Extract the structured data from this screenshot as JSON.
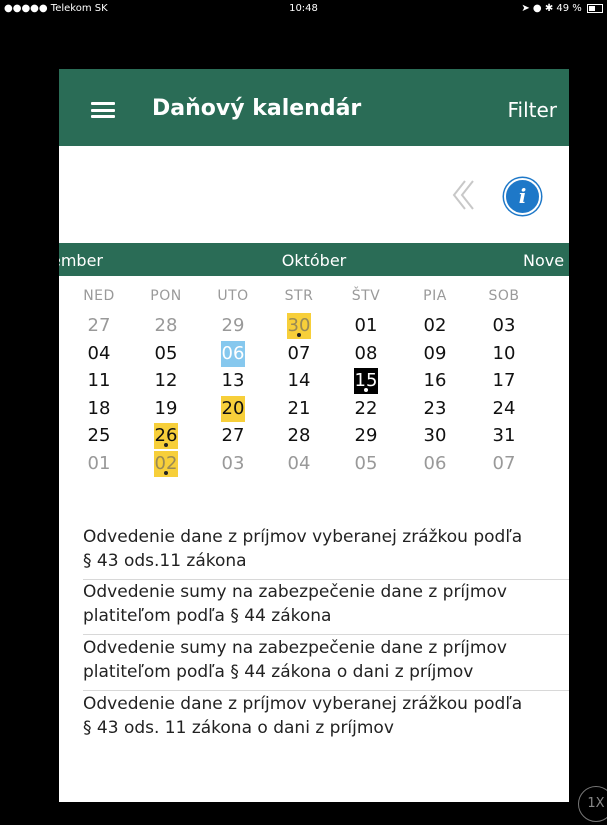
{
  "status_bar": {
    "carrier": "●●●●● Telekom SK",
    "time": "10:48",
    "battery": "49 %"
  },
  "header": {
    "title": "Daňový kalendár",
    "filter_label": "Filter",
    "menu_icon": "hamburger-menu-icon"
  },
  "toolbar": {
    "back_icon": "double-chevron-left-icon",
    "info_label": "i",
    "info_color": "#1e78c8"
  },
  "months": {
    "prev": "ember",
    "current": "Október",
    "next": "Nove"
  },
  "weekdays": [
    "NED",
    "PON",
    "UTO",
    "STR",
    "ŠTV",
    "PIA",
    "SOB"
  ],
  "calendar": {
    "weeks": [
      [
        {
          "d": "27",
          "muted": true
        },
        {
          "d": "28",
          "muted": true
        },
        {
          "d": "29",
          "muted": true
        },
        {
          "d": "30",
          "muted": true,
          "hl": "yellow",
          "dot": true
        },
        {
          "d": "01"
        },
        {
          "d": "02"
        },
        {
          "d": "03"
        }
      ],
      [
        {
          "d": "04"
        },
        {
          "d": "05"
        },
        {
          "d": "06",
          "hl": "blue"
        },
        {
          "d": "07"
        },
        {
          "d": "08"
        },
        {
          "d": "09"
        },
        {
          "d": "10"
        }
      ],
      [
        {
          "d": "11"
        },
        {
          "d": "12"
        },
        {
          "d": "13"
        },
        {
          "d": "14"
        },
        {
          "d": "15",
          "hl": "black",
          "dot": true
        },
        {
          "d": "16"
        },
        {
          "d": "17"
        }
      ],
      [
        {
          "d": "18"
        },
        {
          "d": "19"
        },
        {
          "d": "20",
          "hl": "yellow"
        },
        {
          "d": "21"
        },
        {
          "d": "22"
        },
        {
          "d": "23"
        },
        {
          "d": "24"
        }
      ],
      [
        {
          "d": "25"
        },
        {
          "d": "26",
          "hl": "yellow",
          "dot": true
        },
        {
          "d": "27"
        },
        {
          "d": "28"
        },
        {
          "d": "29"
        },
        {
          "d": "30"
        },
        {
          "d": "31"
        }
      ],
      [
        {
          "d": "01",
          "muted": true
        },
        {
          "d": "02",
          "muted": true,
          "hl": "yellow",
          "dot": true
        },
        {
          "d": "03",
          "muted": true
        },
        {
          "d": "04",
          "muted": true
        },
        {
          "d": "05",
          "muted": true
        },
        {
          "d": "06",
          "muted": true
        },
        {
          "d": "07",
          "muted": true
        }
      ]
    ],
    "colors": {
      "yellow": "#f7cf3a",
      "blue": "#86c8ee",
      "black": "#000000"
    }
  },
  "events": [
    {
      "line1": "Odvedenie dane z príjmov vyberanej zrážkou podľa",
      "line2": "§ 43 ods.11 zákona"
    },
    {
      "line1": "Odvedenie sumy na zabezpečenie dane z príjmov",
      "line2": "platiteľom podľa § 44 zákona"
    },
    {
      "line1": "Odvedenie sumy na zabezpečenie dane z príjmov",
      "line2": "platiteľom  podľa § 44 zákona o dani z príjmov"
    },
    {
      "line1": "Odvedenie dane z príjmov vyberanej zrážkou podľa",
      "line2": "§ 43 ods. 11 zákona o dani z príjmov"
    }
  ],
  "zoom_label": "1X",
  "theme": {
    "primary": "#2a6c56"
  }
}
